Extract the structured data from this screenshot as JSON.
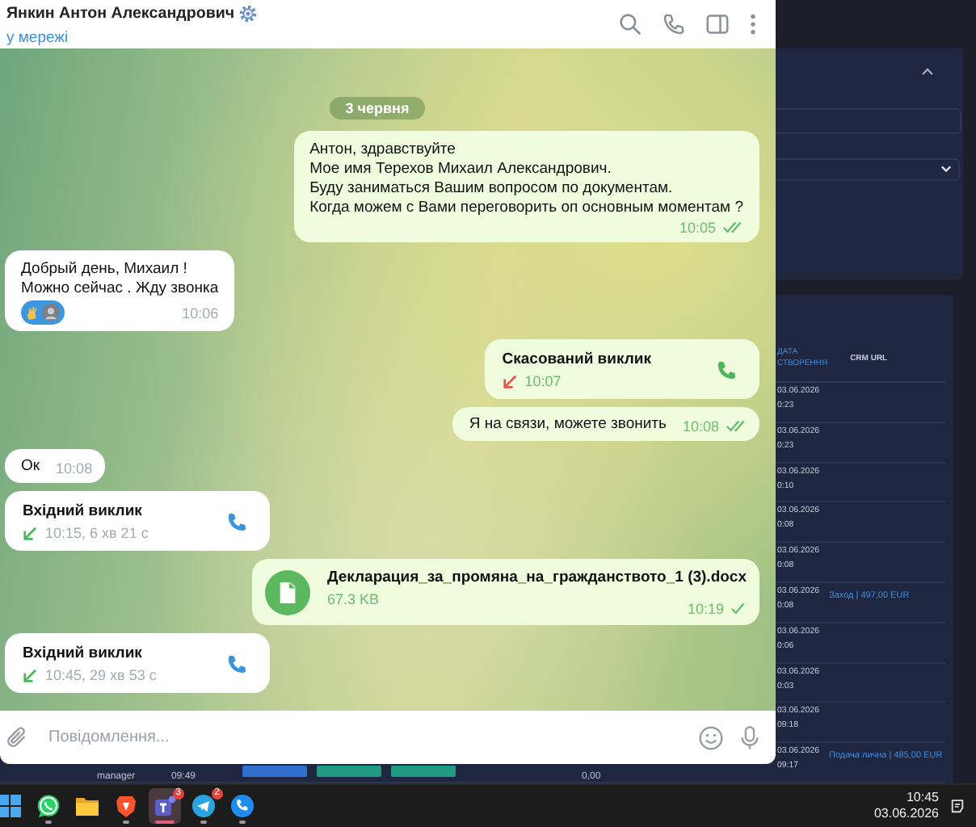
{
  "chat": {
    "title": "Янкин Антон Александрович",
    "status": "у мережі"
  },
  "messages": [
    {
      "kind": "date",
      "text": "3 червня"
    },
    {
      "kind": "text",
      "outgoing": true,
      "text": "Антон, здравствуйте\nМое имя Терехов Михаил Александрович.\nБуду заниматься Вашим вопросом по документам.\nКогда можем с Вами переговорить оп основным моментам ?",
      "time": "10:05",
      "read": true
    },
    {
      "kind": "text",
      "outgoing": false,
      "text": "Добрый день, Михаил !\nМожно сейчас . Жду звонка",
      "time": "10:06",
      "reacted": true
    },
    {
      "kind": "call",
      "outgoing": true,
      "title": "Скасований виклик",
      "detail": "10:07",
      "missed": true
    },
    {
      "kind": "text",
      "outgoing": true,
      "text": "Я на связи, можете звонить",
      "time": "10:08",
      "read": true
    },
    {
      "kind": "text",
      "outgoing": false,
      "text": "Ок",
      "time": "10:08",
      "reacted": false
    },
    {
      "kind": "call",
      "outgoing": false,
      "title": "Вхідний виклик",
      "detail": "10:15, 6 хв 21 с",
      "missed": false
    },
    {
      "kind": "file",
      "outgoing": true,
      "name": "Декларация_за_промяна_на_гражданството_1 (3).docx",
      "size": "67.3 KB",
      "time": "10:19",
      "read": false
    },
    {
      "kind": "call",
      "outgoing": false,
      "title": "Вхідний виклик",
      "detail": "10:45, 29 хв 53 с",
      "missed": false
    }
  ],
  "composer": {
    "placeholder": "Повідомлення..."
  },
  "background_app": {
    "columns": [
      "ДАТА\nСТВОРЕННЯ",
      "CRM URL"
    ],
    "rows": [
      {
        "date": "03.06.2026",
        "time": "0:23"
      },
      {
        "date": "03.06.2026",
        "time": "0:23"
      },
      {
        "date": "03.06.2026",
        "time": "0:10"
      },
      {
        "date": "03.06.2026",
        "time": "0:08"
      },
      {
        "date": "03.06.2026",
        "time": "0:08"
      },
      {
        "date": "03.06.2026",
        "time": "0:08",
        "crm": "Заход | 497,00 EUR"
      },
      {
        "date": "03.06.2026",
        "time": "0:06"
      },
      {
        "date": "03.06.2026",
        "time": "0:03"
      },
      {
        "date": "03.06.2026",
        "time": "09:18"
      },
      {
        "date": "03.06.2026",
        "time": "09:17",
        "crm": "Подача лична | 485,00 EUR",
        "user": "manager",
        "created": "09:49",
        "tags": [
          {
            "color": "#2f6fd0"
          },
          {
            "color": "#1f9a82"
          },
          {
            "color": "#1f9a82"
          }
        ],
        "amount": "0,00"
      }
    ]
  },
  "taskbar": {
    "apps": [
      {
        "kind": "start",
        "running": false,
        "selected": false
      },
      {
        "kind": "whatsapp",
        "running": true,
        "selected": false
      },
      {
        "kind": "folder",
        "running": false,
        "selected": false
      },
      {
        "kind": "brave",
        "running": true,
        "selected": false
      },
      {
        "kind": "teams",
        "running": true,
        "selected": true,
        "badge": "3"
      },
      {
        "kind": "telegram",
        "running": true,
        "selected": false,
        "badge": "2"
      },
      {
        "kind": "phone",
        "running": true,
        "selected": false
      }
    ],
    "time": "10:45",
    "date": "03.06.2026"
  }
}
